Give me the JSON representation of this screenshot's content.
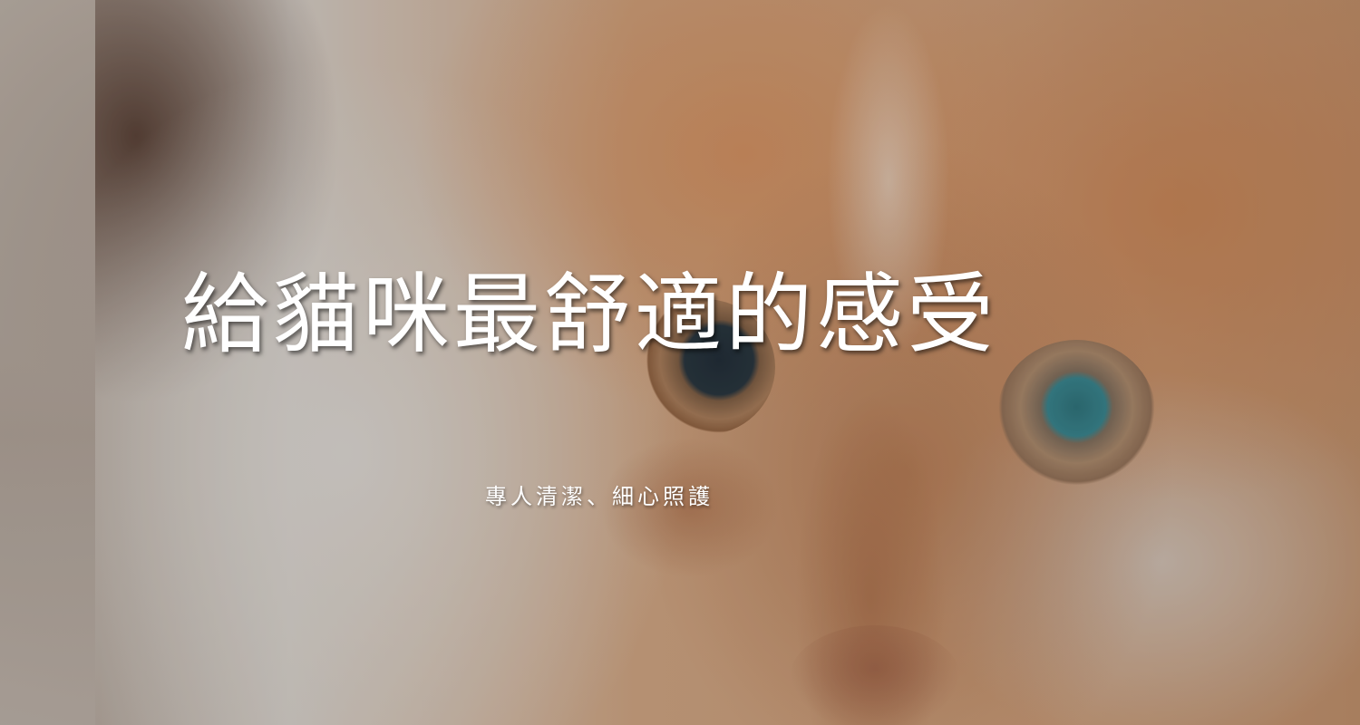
{
  "hero": {
    "title": "給貓咪最舒適的感受",
    "subtitle": "專人清潔、細心照護",
    "background_image": "close-up of calico cat face",
    "text_color": "#ffffff"
  }
}
